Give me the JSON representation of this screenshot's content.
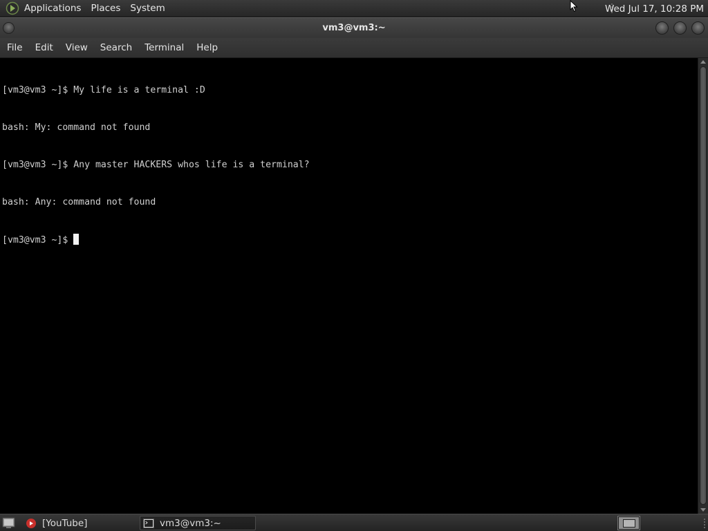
{
  "top_panel": {
    "menus": [
      "Applications",
      "Places",
      "System"
    ],
    "clock": "Wed Jul 17, 10:28 PM",
    "apps_icon": "gnome-foot-icon"
  },
  "window": {
    "title": "vm3@vm3:~",
    "buttons": [
      "window-menu",
      "minimize",
      "maximize",
      "close"
    ]
  },
  "menubar": {
    "items": [
      "File",
      "Edit",
      "View",
      "Search",
      "Terminal",
      "Help"
    ]
  },
  "terminal": {
    "lines": [
      "[vm3@vm3 ~]$ My life is a terminal :D",
      "bash: My: command not found",
      "[vm3@vm3 ~]$ Any master HACKERS whos life is a terminal?",
      "bash: Any: command not found"
    ],
    "prompt": "[vm3@vm3 ~]$ ",
    "background": "#000000",
    "foreground": "#d0d0d0"
  },
  "taskbar": {
    "tasks": [
      {
        "label": "[YouTube]",
        "icon": "youtube-icon",
        "active": false
      },
      {
        "label": "vm3@vm3:~",
        "icon": "terminal-icon",
        "active": true
      }
    ],
    "workspaces": 1
  }
}
